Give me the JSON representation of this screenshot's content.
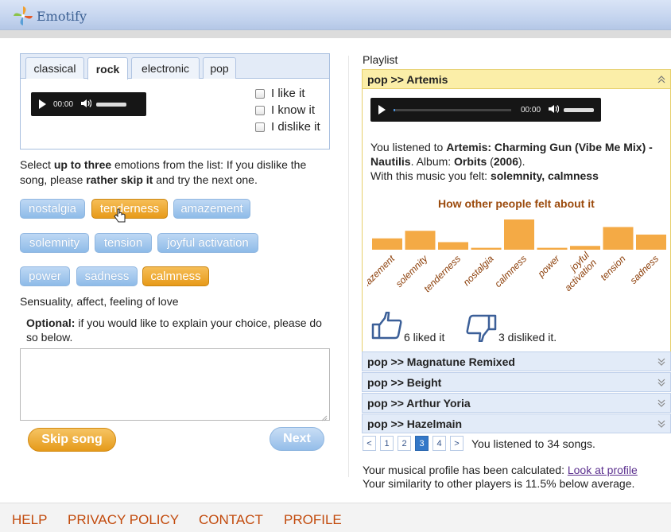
{
  "app": {
    "title": "Emotify",
    "logo_icon": "pinwheel-logo-icon"
  },
  "genre_tabs": [
    {
      "label": "classical",
      "active": false
    },
    {
      "label": "rock",
      "active": true
    },
    {
      "label": "electronic",
      "active": false
    },
    {
      "label": "pop",
      "active": false
    }
  ],
  "player": {
    "time": "00:00"
  },
  "feedback_checks": [
    {
      "label": "I like it",
      "checked": false
    },
    {
      "label": "I know it",
      "checked": false
    },
    {
      "label": "I dislike it",
      "checked": false
    }
  ],
  "instructions": {
    "p1": "Select ",
    "b1": "up to three",
    "p2": " emotions from the list: If you dislike the song, please ",
    "b2": "rather skip it",
    "p3": " and try the next one."
  },
  "emotions": [
    {
      "label": "nostalgia",
      "selected": false
    },
    {
      "label": "tenderness",
      "selected": true
    },
    {
      "label": "amazement",
      "selected": false
    },
    {
      "label": "solemnity",
      "selected": false
    },
    {
      "label": "tension",
      "selected": false
    },
    {
      "label": "joyful activation",
      "selected": false
    },
    {
      "label": "power",
      "selected": false
    },
    {
      "label": "sadness",
      "selected": false
    },
    {
      "label": "calmness",
      "selected": true
    }
  ],
  "emotion_description": "Sensuality, affect, feeling of love",
  "optional": {
    "bold": "Optional:",
    "text": " if you would like to explain your choice, please do so below."
  },
  "comment": {
    "value": ""
  },
  "buttons": {
    "skip": "Skip song",
    "next": "Next"
  },
  "playlist": {
    "label": "Playlist",
    "current": {
      "title": "pop >> Artemis",
      "time": "00:00",
      "listened_prefix": "You listened to ",
      "song": "Artemis: Charming Gun (Vibe Me Mix) - Nautilis",
      "album_prefix": ". Album: ",
      "album": "Orbits",
      "year_open": " (",
      "year": "2006",
      "year_close": ").",
      "felt_prefix": "With this music you felt: ",
      "felt": "solemnity, calmness",
      "liked_text": "6 liked it",
      "disliked_text": "3 disliked it."
    },
    "others": [
      "pop >> Magnatune Remixed",
      "pop >> Beight",
      "pop >> Arthur Yoria",
      "pop >> Hazelmain"
    ]
  },
  "pager": {
    "prev": "<",
    "pages": [
      "1",
      "2",
      "3",
      "4"
    ],
    "current": "3",
    "next": ">",
    "count_text": "You listened to 34 songs."
  },
  "profile": {
    "text1": "Your musical profile has been calculated: ",
    "link": "Look at profile",
    "text2": "Your similarity to other players is 11.5% below average."
  },
  "footer": [
    "HELP",
    "PRIVACY POLICY",
    "CONTACT",
    "PROFILE"
  ],
  "colors": {
    "accent_orange": "#f4aa45",
    "header_blue": "#c3d3ee",
    "selected_orange": "#e79a19",
    "link_purple": "#5b2f8e"
  },
  "chart_data": {
    "type": "bar",
    "title": "How other people felt about it",
    "categories": [
      "amazement",
      "solemnity",
      "tenderness",
      "nostalgia",
      "calmness",
      "power",
      "joyful activation",
      "tension",
      "sadness"
    ],
    "values": [
      3,
      5,
      2,
      0.5,
      8,
      0.5,
      1,
      6,
      4
    ],
    "ylim": [
      0,
      8
    ],
    "grid": false
  }
}
